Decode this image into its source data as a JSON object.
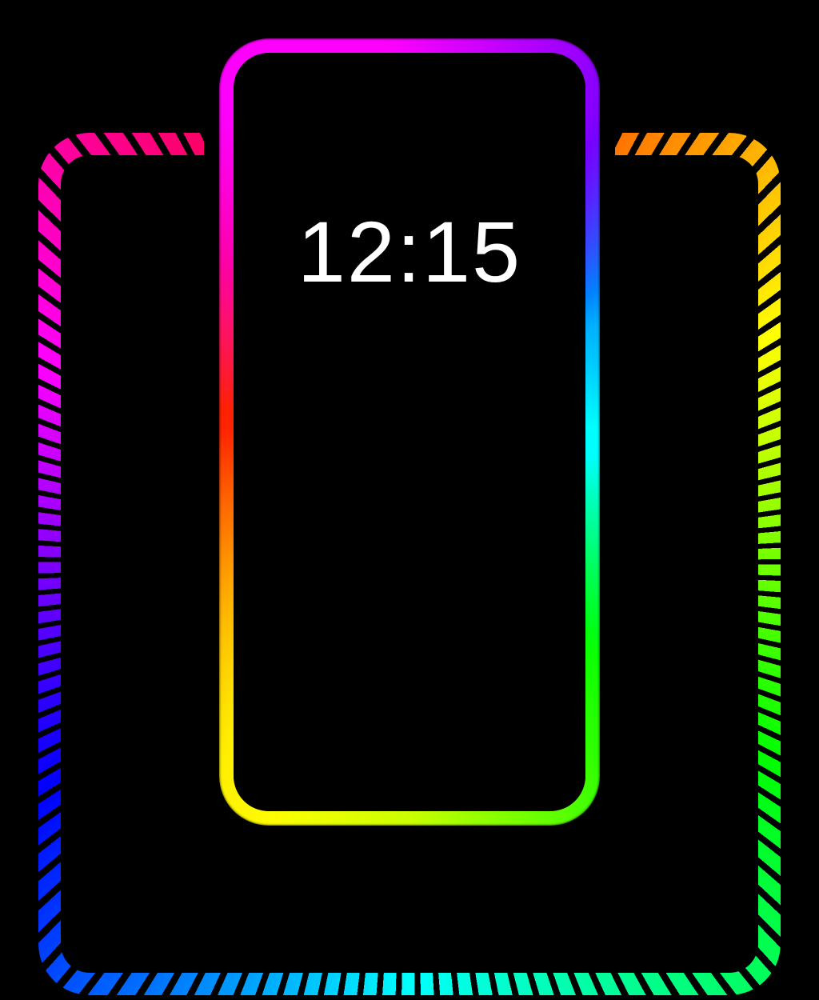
{
  "clock": {
    "time": "12:15"
  }
}
